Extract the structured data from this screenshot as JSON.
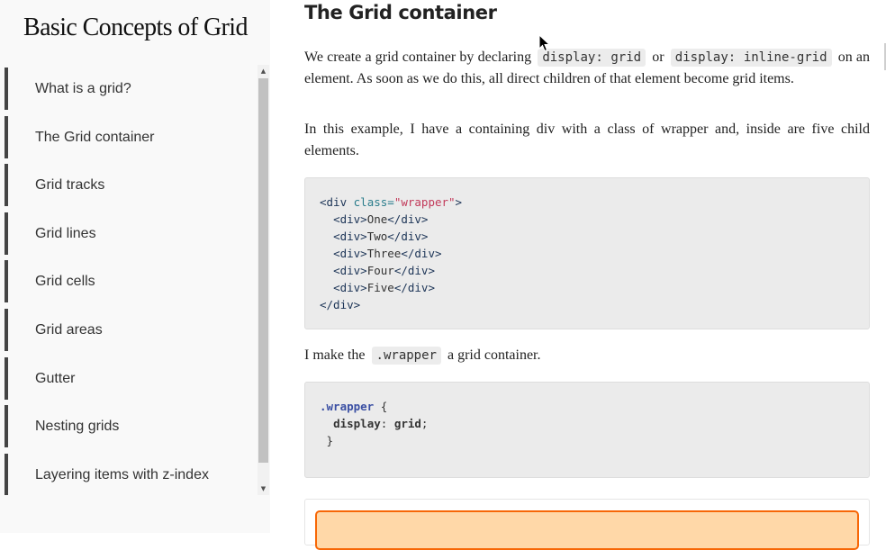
{
  "sidebar": {
    "title": "Basic Concepts of Grid",
    "items": [
      {
        "label": "What is a grid?"
      },
      {
        "label": "The Grid container"
      },
      {
        "label": "Grid tracks"
      },
      {
        "label": "Grid lines"
      },
      {
        "label": "Grid cells"
      },
      {
        "label": "Grid areas"
      },
      {
        "label": "Gutter"
      },
      {
        "label": "Nesting grids"
      },
      {
        "label": "Layering items with z-index"
      }
    ],
    "scroll_up_icon": "▲",
    "scroll_down_icon": "▼"
  },
  "main": {
    "heading": "The Grid container",
    "para1": {
      "t1": "We create a grid container by declaring",
      "c1": "display: grid",
      "t2": "or",
      "c2": "display: inline-grid",
      "t3": "on an element. As soon as we do this, all direct children of that element become grid items."
    },
    "para2": "In this example, I have a containing div with a class of wrapper and, inside are five child elements.",
    "code1": {
      "open_tag": "<div",
      "attr": "class",
      "eq": "=",
      "value": "\"wrapper\"",
      "close_bracket": ">",
      "children": [
        "One",
        "Two",
        "Three",
        "Four",
        "Five"
      ],
      "child_open": "<div>",
      "child_close": "</div>",
      "end_tag": "</div>"
    },
    "para3": {
      "t1": "I make the",
      "c1": ".wrapper",
      "t2": "a grid container."
    },
    "code2": {
      "selector": ".wrapper",
      "brace_open": "{",
      "property": "display",
      "colon": ":",
      "value": "grid",
      "semicolon": ";",
      "brace_close": "}"
    }
  },
  "colors": {
    "demo_item_bg": "#ffd8a8",
    "demo_item_border": "#f76707"
  }
}
